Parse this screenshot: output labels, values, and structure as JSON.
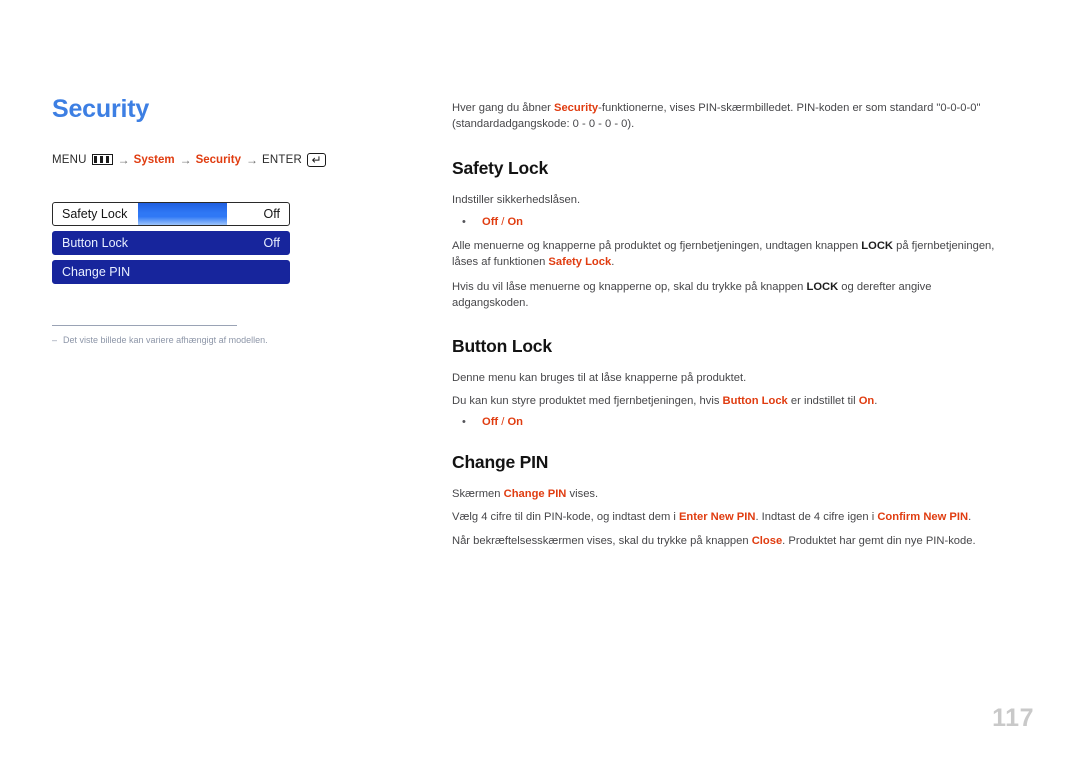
{
  "page": {
    "title": "Security",
    "number": "117",
    "language": "da"
  },
  "menu_path": {
    "menu_label": "MENU",
    "menu_icon": "menu-bars-icon",
    "arrow": "→",
    "step1": "System",
    "step2": "Security",
    "enter_label": "ENTER",
    "enter_icon": "enter-return-icon",
    "enter_glyph": "↵"
  },
  "osd": {
    "rows": [
      {
        "label": "Safety Lock",
        "value": "Off",
        "state": "selected"
      },
      {
        "label": "Button Lock",
        "value": "Off",
        "state": "plain"
      },
      {
        "label": "Change PIN",
        "value": "",
        "state": "plain"
      }
    ]
  },
  "footnote": {
    "dash": "–",
    "text": "Det viste billede kan variere afhængigt af modellen."
  },
  "intro": {
    "part1": "Hver gang du åbner ",
    "accent1": "Security",
    "part2": "-funktionerne, vises PIN-skærmbilledet. PIN-koden er som standard \"0-0-0-0\" (standardadgangskode: 0 - 0 - 0 - 0)."
  },
  "sections": [
    {
      "heading": "Safety Lock",
      "p1": "Indstiller sikkerhedslåsen.",
      "bullet": {
        "off": "Off",
        "sep": " / ",
        "on": "On"
      },
      "p2_part1": "Alle menuerne og knapperne på produktet og fjernbetjeningen, undtagen knappen ",
      "p2_bold1": "LOCK",
      "p2_part2": " på fjernbetjeningen, låses af funktionen ",
      "p2_accent1": "Safety Lock",
      "p2_part3": ".",
      "p3_part1": "Hvis du vil låse menuerne og knapperne op, skal du trykke på knappen ",
      "p3_bold1": "LOCK",
      "p3_part2": " og derefter angive adgangskoden."
    },
    {
      "heading": "Button Lock",
      "p1": "Denne menu kan bruges til at låse knapperne på produktet.",
      "p2_part1": "Du kan kun styre produktet med fjernbetjeningen, hvis ",
      "p2_accent1": "Button Lock",
      "p2_part2": " er indstillet til ",
      "p2_accent2": "On",
      "p2_part3": ".",
      "bullet": {
        "off": "Off",
        "sep": " / ",
        "on": "On"
      }
    },
    {
      "heading": "Change PIN",
      "p1_part1": "Skærmen ",
      "p1_accent1": "Change PIN",
      "p1_part2": " vises.",
      "p2_part1": "Vælg 4 cifre til din PIN-kode, og indtast dem i ",
      "p2_accent1": "Enter New PIN",
      "p2_part2": ". Indtast de 4 cifre igen i ",
      "p2_accent2": "Confirm New PIN",
      "p2_part3": ".",
      "p3_part1": "Når bekræftelsesskærmen vises, skal du trykke på knappen ",
      "p3_accent1": "Close",
      "p3_part2": ". Produktet har gemt din nye PIN-kode."
    }
  ],
  "colors": {
    "title_blue": "#3d7fe3",
    "accent_red": "#e03c10",
    "osd_navy": "#17259c",
    "osd_highlight": "#2f78f5",
    "page_number_gray": "#c9c9c9"
  }
}
